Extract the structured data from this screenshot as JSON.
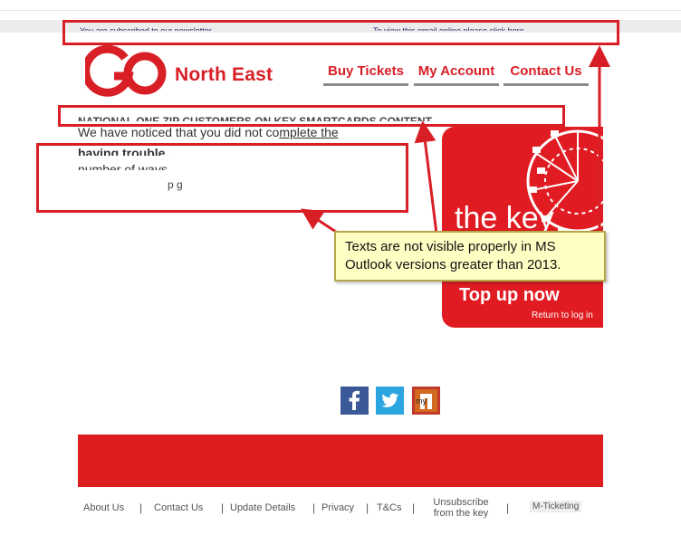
{
  "preheader": {
    "left_text": "You are subscribed to our newsletter",
    "right_text": "To view this email online please click here"
  },
  "brand": {
    "name": "North East",
    "logo_icon": "go-logo-icon",
    "color": "#d81f26"
  },
  "nav": {
    "items": [
      {
        "label": "Buy Tickets"
      },
      {
        "label": "My Account"
      },
      {
        "label": "Contact Us"
      }
    ]
  },
  "body": {
    "line1": "NATIONAL ONE ZIP CUSTOMERS ON KEY SMARTCARDS CONTENT",
    "line2_prefix": "We have noticed that you did not co",
    "line2_underlined": "mplete the",
    "line3": "having trouble.",
    "line4": "number of ways.",
    "line5": "p                              g"
  },
  "key_card": {
    "key_label": "the key",
    "topup_title": "Top up now",
    "topup_sub": "Return to log in"
  },
  "annotation": {
    "callout_line1": "Texts are not visible properly in MS",
    "callout_line2": "Outlook versions greater than 2013.",
    "box_color": "#d81f26",
    "callout_bg": "#ffffc4"
  },
  "social": [
    {
      "icon": "facebook-icon",
      "glyph": "f"
    },
    {
      "icon": "twitter-icon",
      "glyph": "t"
    },
    {
      "icon": "mticket-icon",
      "glyph": "m"
    }
  ],
  "footer": {
    "links": [
      {
        "label": "About Us"
      },
      {
        "label": "Contact Us"
      },
      {
        "label": "Update Details"
      },
      {
        "label": "Privacy"
      },
      {
        "label": "T&Cs"
      }
    ],
    "unsubscribe_line1": "Unsubscribe",
    "unsubscribe_line2": "from the key",
    "mticketing": "M-Ticketing",
    "separator": "|"
  }
}
